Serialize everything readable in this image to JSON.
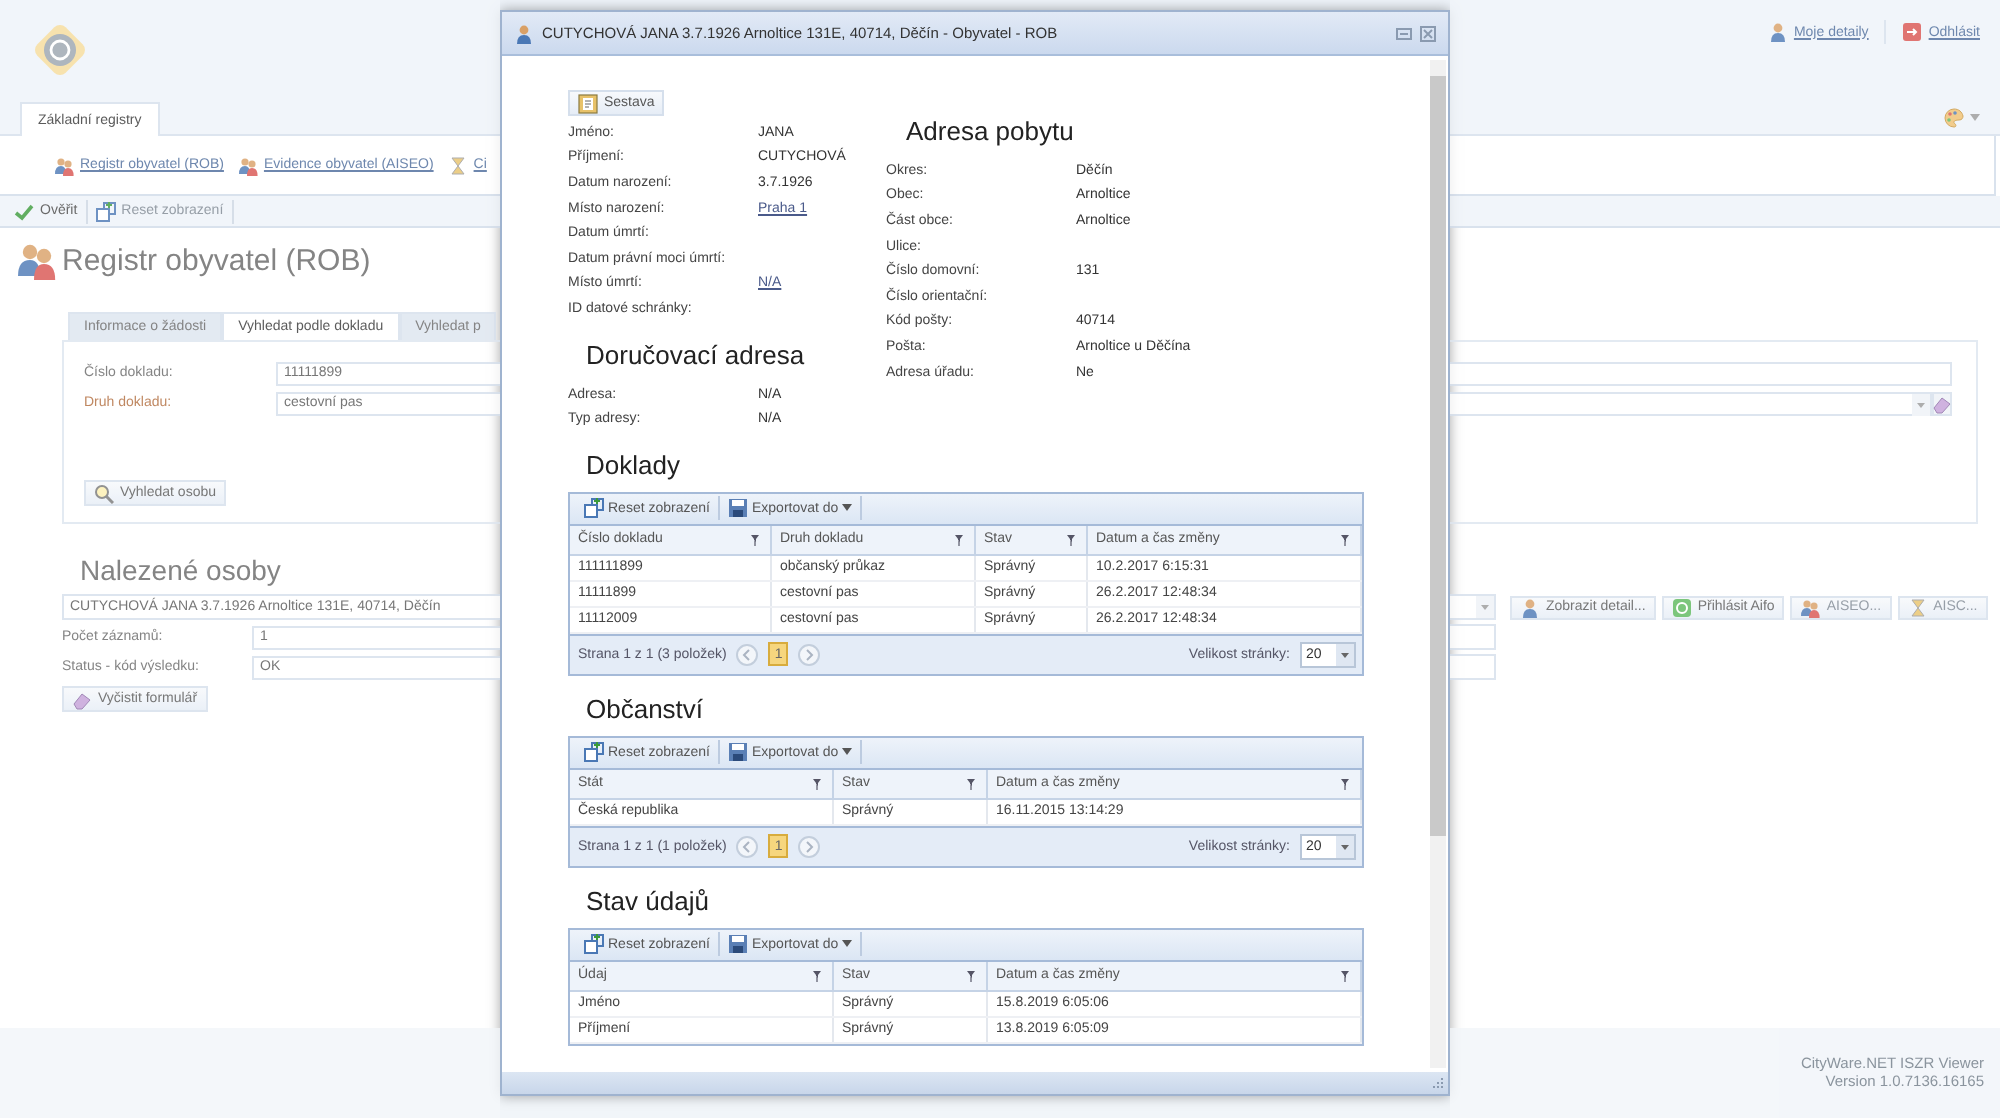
{
  "app": {
    "header_links": [
      {
        "label": "Moje detaily"
      },
      {
        "label": "Odhlásit"
      }
    ],
    "main_tabs": [
      {
        "label": "Základní registry",
        "selected": true
      }
    ],
    "register_links": [
      {
        "label": "Registr obyvatel (ROB)"
      },
      {
        "label": "Evidence obyvatel (AISEO)"
      },
      {
        "label": "Ci"
      }
    ],
    "toolbar": [
      {
        "label": "Ověřit",
        "disabled": false
      },
      {
        "label": "Reset zobrazení",
        "disabled": true
      }
    ],
    "page_title": "Registr obyvatel (ROB)",
    "search_tabs": [
      {
        "label": "Informace o žádosti",
        "selected": false
      },
      {
        "label": "Vyhledat podle dokladu",
        "selected": true
      },
      {
        "label": "Vyhledat p",
        "selected": false
      }
    ],
    "search_fields": [
      {
        "label": "Číslo dokladu:",
        "value": "11111899",
        "required": false
      },
      {
        "label": "Druh dokladu:",
        "value": "cestovní pas",
        "required": true
      }
    ],
    "search_button": "Vyhledat osobu",
    "results_heading": "Nalezené osoby",
    "person_select": "CUTYCHOVÁ JANA 3.7.1926 Arnoltice 131E, 40714, Děčín",
    "result_fields": [
      {
        "label": "Počet záznamů:",
        "value": "1"
      },
      {
        "label": "Status - kód výsledku:",
        "value": "OK"
      }
    ],
    "clear_button": "Vyčistit formulář",
    "actions": [
      {
        "label": "Zobrazit detail...",
        "disabled": false
      },
      {
        "label": "Přihlásit Aifo",
        "disabled": false
      },
      {
        "label": "AISEO...",
        "disabled": true
      },
      {
        "label": "AISC...",
        "disabled": true
      }
    ],
    "footer": [
      "CityWare.NET ISZR Viewer",
      "Version 1.0.7136.16165"
    ]
  },
  "dialog": {
    "title": "CUTYCHOVÁ JANA 3.7.1926 Arnoltice 131E, 40714, Děčín - Obyvatel - ROB",
    "report_button": "Sestava",
    "person": [
      {
        "label": "Jméno:",
        "value": "JANA",
        "link": false
      },
      {
        "label": "Příjmení:",
        "value": "CUTYCHOVÁ",
        "link": false
      },
      {
        "label": "Datum narození:",
        "value": "3.7.1926",
        "link": false
      },
      {
        "label": "Místo narození:",
        "value": "Praha 1",
        "link": true
      },
      {
        "label": "Datum úmrtí:"
      },
      {
        "label": "Datum právní moci úmrtí:"
      },
      {
        "label": "Místo úmrtí:",
        "value": "N/A",
        "link": true
      },
      {
        "label": "ID datové schránky:"
      }
    ],
    "delivery_address": {
      "heading": "Doručovací adresa",
      "rows": [
        {
          "label": "Adresa:",
          "value": "N/A"
        },
        {
          "label": "Typ adresy:",
          "value": "N/A"
        }
      ]
    },
    "residence_address": {
      "heading": "Adresa pobytu",
      "rows": [
        {
          "label": "Okres:",
          "value": "Děčín"
        },
        {
          "label": "Obec:",
          "value": "Arnoltice"
        },
        {
          "label": "Část obce:",
          "value": "Arnoltice"
        },
        {
          "label": "Ulice:"
        },
        {
          "label": "Číslo domovní:",
          "value": "131"
        },
        {
          "label": "Číslo orientační:"
        },
        {
          "label": "Kód pošty:",
          "value": "40714"
        },
        {
          "label": "Pošta:",
          "value": "Arnoltice u Děčína"
        },
        {
          "label": "Adresa úřadu:",
          "value": "Ne"
        }
      ]
    },
    "grids": [
      {
        "heading": "Doklady",
        "reset_button": "Reset zobrazení",
        "export_button": "Exportovat do",
        "columns": [
          "Číslo dokladu",
          "Druh dokladu",
          "Stav",
          "Datum a čas změny"
        ],
        "rows": [
          [
            "111111899",
            "občanský průkaz",
            "Správný",
            "10.2.2017 6:15:31"
          ],
          [
            "11111899",
            "cestovní pas",
            "Správný",
            "26.2.2017 12:48:34"
          ],
          [
            "11112009",
            "cestovní pas",
            "Správný",
            "26.2.2017 12:48:34"
          ]
        ],
        "pager": {
          "summary": "Strana 1 z 1 (3 položek)",
          "pages": [
            {
              "label": "1",
              "selected": true
            }
          ],
          "page_size_label": "Velikost stránky:",
          "page_size": "20"
        }
      },
      {
        "heading": "Občanství",
        "reset_button": "Reset zobrazení",
        "export_button": "Exportovat do",
        "columns": [
          "Stát",
          "Stav",
          "Datum a čas změny"
        ],
        "rows": [
          [
            "Česká republika",
            "Správný",
            "16.11.2015 13:14:29"
          ]
        ],
        "pager": {
          "summary": "Strana 1 z 1 (1 položek)",
          "pages": [
            {
              "label": "1",
              "selected": true
            }
          ],
          "page_size_label": "Velikost stránky:",
          "page_size": "20"
        }
      },
      {
        "heading": "Stav údajů",
        "reset_button": "Reset zobrazení",
        "export_button": "Exportovat do",
        "columns": [
          "Údaj",
          "Stav",
          "Datum a čas změny"
        ],
        "rows": [
          [
            "Jméno",
            "Správný",
            "15.8.2019 6:05:06"
          ],
          [
            "Příjmení",
            "Správný",
            "13.8.2019 6:05:09"
          ]
        ]
      }
    ]
  }
}
